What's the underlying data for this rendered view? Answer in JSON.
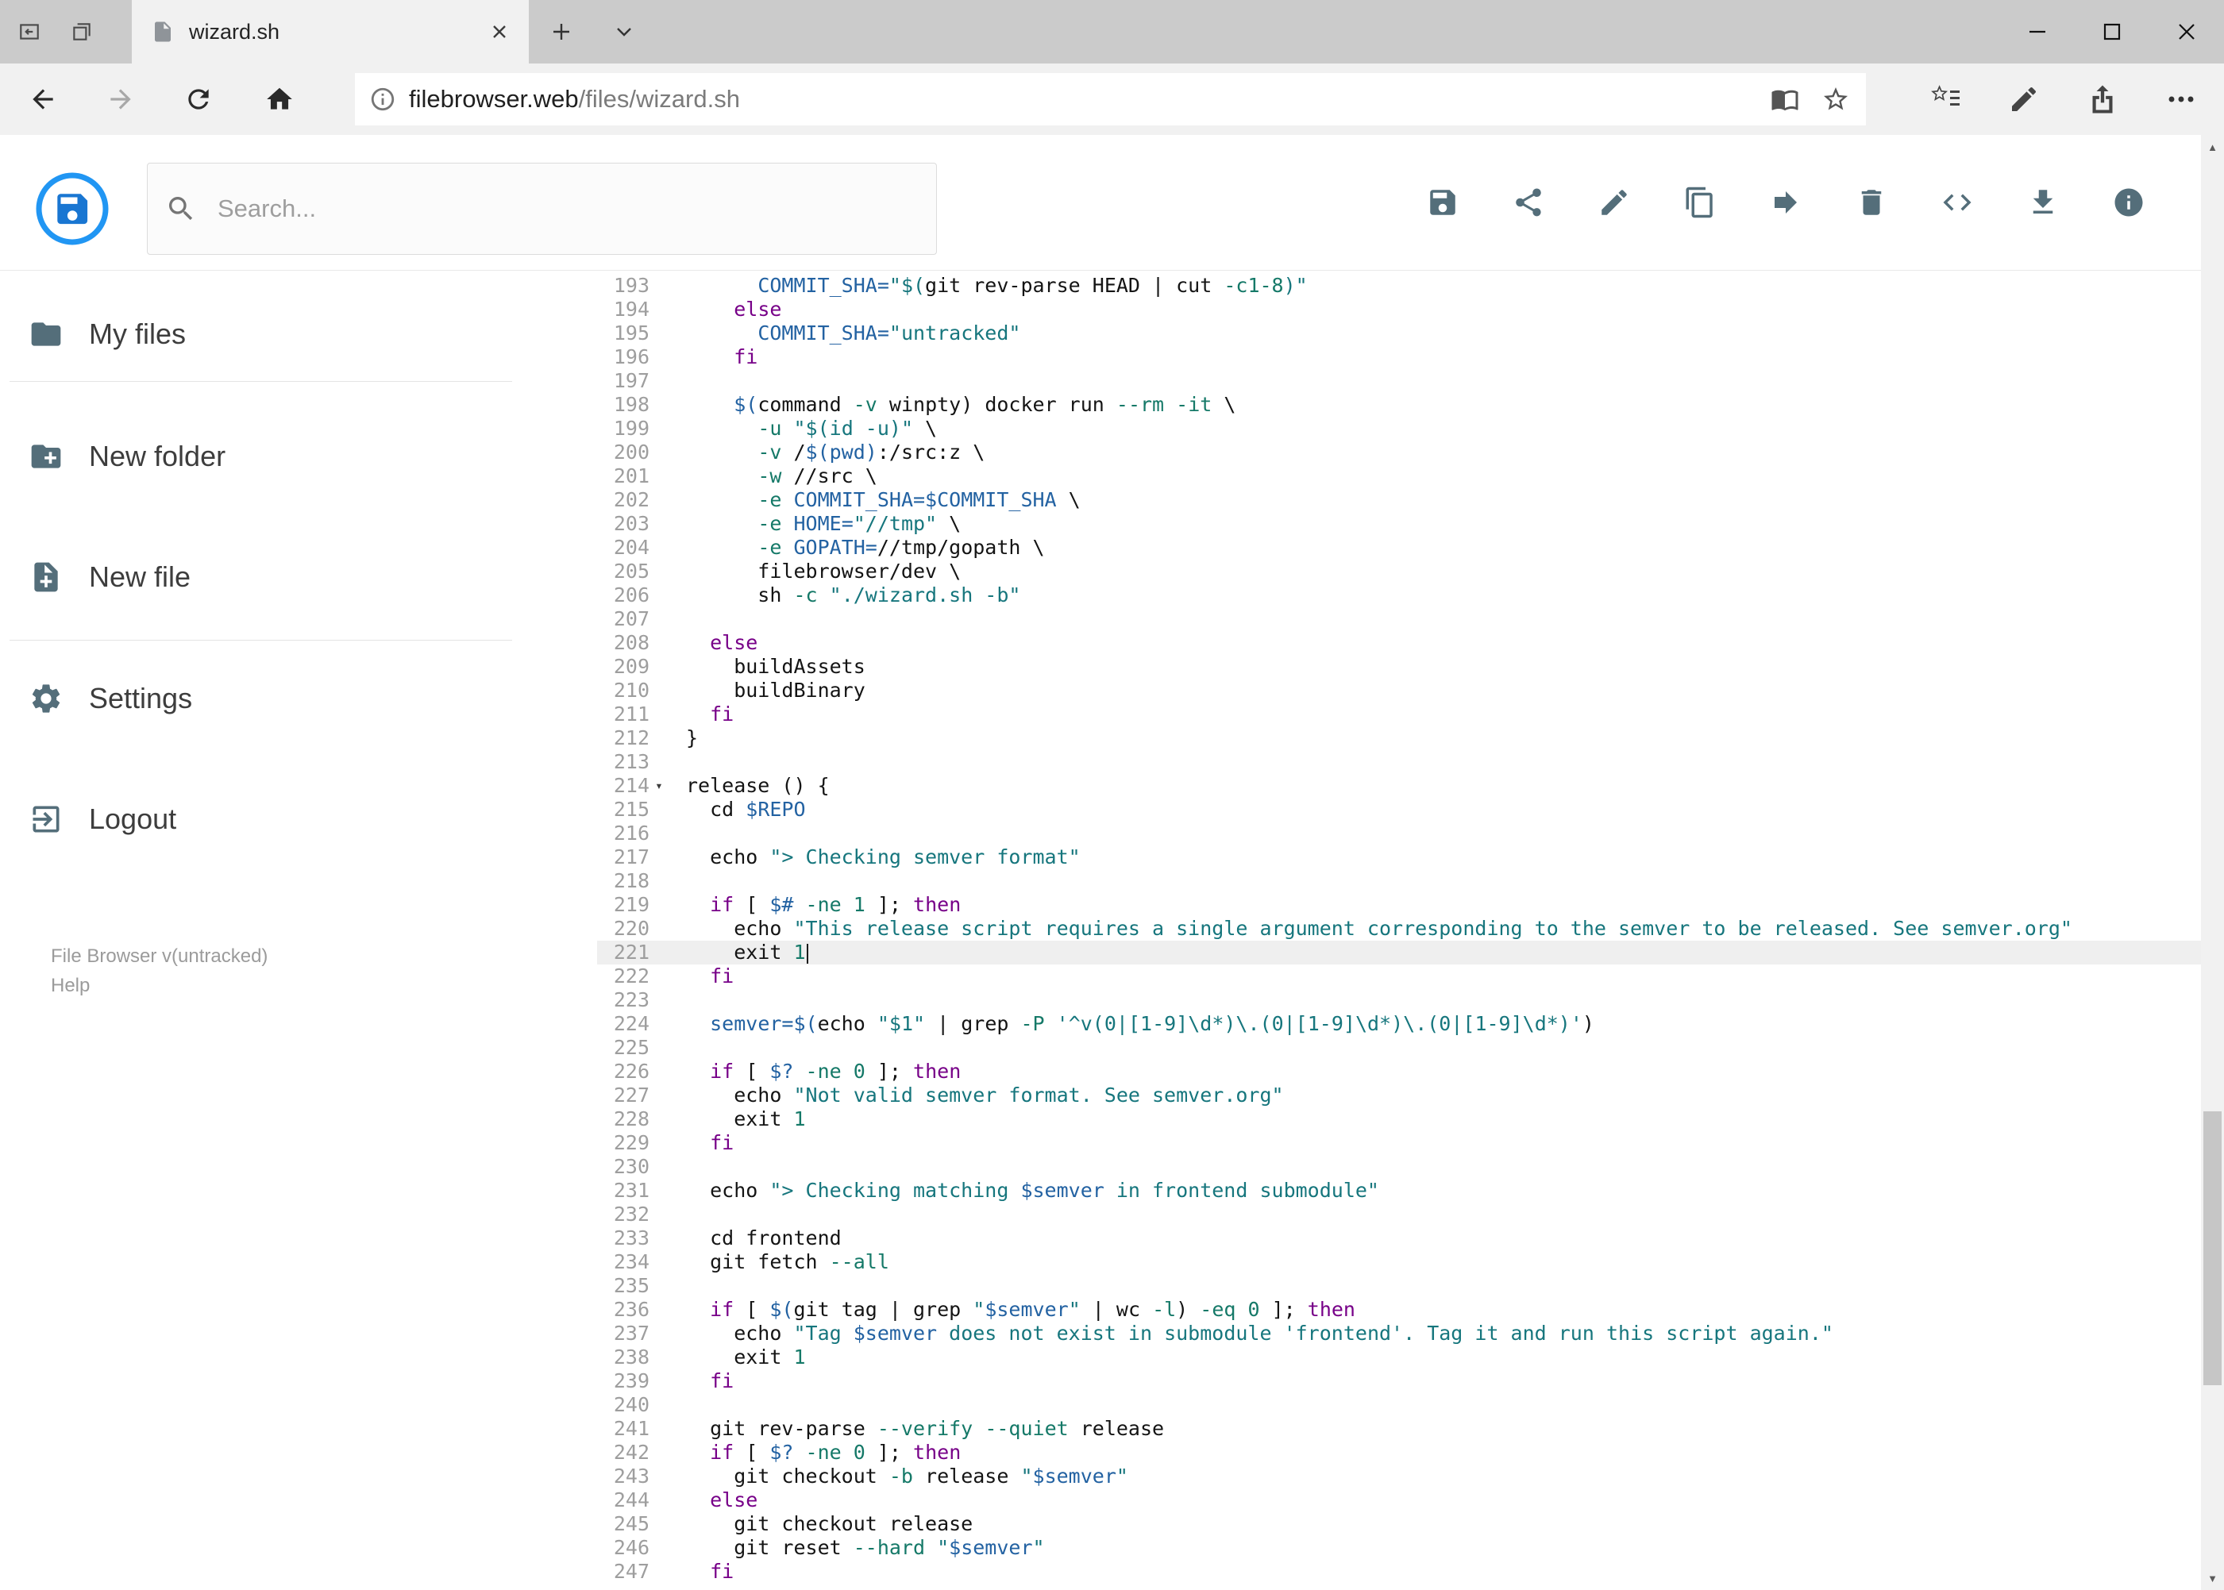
{
  "browser": {
    "tab_title": "wizard.sh",
    "url_domain": "filebrowser.web",
    "url_path": "/files/wizard.sh"
  },
  "header": {
    "search_placeholder": "Search...",
    "toolbar_icons": [
      "save-icon",
      "share-icon",
      "edit-icon",
      "copy-icon",
      "move-icon",
      "delete-icon",
      "code-icon",
      "download-icon",
      "info-icon"
    ]
  },
  "sidebar": {
    "items": [
      {
        "label": "My files",
        "icon": "folder-icon"
      },
      {
        "label": "New folder",
        "icon": "new-folder-icon"
      },
      {
        "label": "New file",
        "icon": "new-file-icon"
      },
      {
        "label": "Settings",
        "icon": "settings-gear-icon"
      },
      {
        "label": "Logout",
        "icon": "logout-icon"
      }
    ],
    "footer_version": "File Browser v(untracked)",
    "footer_help": "Help"
  },
  "colors": {
    "accent_blue": "#2196f3",
    "icon_gray": "#546e7a",
    "keyword": "#770088",
    "string": "#16767d",
    "variable": "#2362a2",
    "number": "#157968",
    "active_line_bg": "#efefef"
  },
  "editor": {
    "active_line": 221,
    "fold_lines": [
      214
    ],
    "lines": [
      {
        "no": 193,
        "t": [
          [
            "p",
            "      "
          ],
          [
            "v",
            "COMMIT_SHA="
          ],
          [
            "s",
            "\"$("
          ],
          [
            "p",
            "git rev-parse HEAD | cut "
          ],
          [
            "n",
            "-c1-8"
          ],
          [
            "s",
            ")\""
          ]
        ]
      },
      {
        "no": 194,
        "t": [
          [
            "p",
            "    "
          ],
          [
            "k",
            "else"
          ]
        ]
      },
      {
        "no": 195,
        "t": [
          [
            "p",
            "      "
          ],
          [
            "v",
            "COMMIT_SHA="
          ],
          [
            "s",
            "\"untracked\""
          ]
        ]
      },
      {
        "no": 196,
        "t": [
          [
            "p",
            "    "
          ],
          [
            "k",
            "fi"
          ]
        ]
      },
      {
        "no": 197,
        "t": []
      },
      {
        "no": 198,
        "t": [
          [
            "p",
            "    "
          ],
          [
            "v",
            "$("
          ],
          [
            "p",
            "command "
          ],
          [
            "n",
            "-v"
          ],
          [
            "p",
            " winpty) docker run "
          ],
          [
            "n",
            "--rm"
          ],
          [
            "p",
            " "
          ],
          [
            "n",
            "-it"
          ],
          [
            "p",
            " \\"
          ]
        ]
      },
      {
        "no": 199,
        "t": [
          [
            "p",
            "      "
          ],
          [
            "n",
            "-u"
          ],
          [
            "p",
            " "
          ],
          [
            "s",
            "\"$(id -u)\""
          ],
          [
            "p",
            " \\"
          ]
        ]
      },
      {
        "no": 200,
        "t": [
          [
            "p",
            "      "
          ],
          [
            "n",
            "-v"
          ],
          [
            "p",
            " /"
          ],
          [
            "v",
            "$(pwd)"
          ],
          [
            "p",
            ":/src:z \\"
          ]
        ]
      },
      {
        "no": 201,
        "t": [
          [
            "p",
            "      "
          ],
          [
            "n",
            "-w"
          ],
          [
            "p",
            " //src \\"
          ]
        ]
      },
      {
        "no": 202,
        "t": [
          [
            "p",
            "      "
          ],
          [
            "n",
            "-e"
          ],
          [
            "p",
            " "
          ],
          [
            "v",
            "COMMIT_SHA=$COMMIT_SHA"
          ],
          [
            "p",
            " \\"
          ]
        ]
      },
      {
        "no": 203,
        "t": [
          [
            "p",
            "      "
          ],
          [
            "n",
            "-e"
          ],
          [
            "p",
            " "
          ],
          [
            "v",
            "HOME="
          ],
          [
            "s",
            "\"//tmp\""
          ],
          [
            "p",
            " \\"
          ]
        ]
      },
      {
        "no": 204,
        "t": [
          [
            "p",
            "      "
          ],
          [
            "n",
            "-e"
          ],
          [
            "p",
            " "
          ],
          [
            "v",
            "GOPATH="
          ],
          [
            "p",
            "//tmp/gopath \\"
          ]
        ]
      },
      {
        "no": 205,
        "t": [
          [
            "p",
            "      filebrowser/dev \\"
          ]
        ]
      },
      {
        "no": 206,
        "t": [
          [
            "p",
            "      sh "
          ],
          [
            "n",
            "-c"
          ],
          [
            "p",
            " "
          ],
          [
            "s",
            "\"./wizard.sh -b\""
          ]
        ]
      },
      {
        "no": 207,
        "t": []
      },
      {
        "no": 208,
        "t": [
          [
            "p",
            "  "
          ],
          [
            "k",
            "else"
          ]
        ]
      },
      {
        "no": 209,
        "t": [
          [
            "p",
            "    buildAssets"
          ]
        ]
      },
      {
        "no": 210,
        "t": [
          [
            "p",
            "    buildBinary"
          ]
        ]
      },
      {
        "no": 211,
        "t": [
          [
            "p",
            "  "
          ],
          [
            "k",
            "fi"
          ]
        ]
      },
      {
        "no": 212,
        "t": [
          [
            "p",
            "}"
          ]
        ]
      },
      {
        "no": 213,
        "t": []
      },
      {
        "no": 214,
        "t": [
          [
            "p",
            "release () {"
          ]
        ]
      },
      {
        "no": 215,
        "t": [
          [
            "p",
            "  cd "
          ],
          [
            "v",
            "$REPO"
          ]
        ]
      },
      {
        "no": 216,
        "t": []
      },
      {
        "no": 217,
        "t": [
          [
            "p",
            "  echo "
          ],
          [
            "s",
            "\"> Checking semver format\""
          ]
        ]
      },
      {
        "no": 218,
        "t": []
      },
      {
        "no": 219,
        "t": [
          [
            "p",
            "  "
          ],
          [
            "k",
            "if"
          ],
          [
            "p",
            " [ "
          ],
          [
            "v",
            "$#"
          ],
          [
            "p",
            " "
          ],
          [
            "n",
            "-ne"
          ],
          [
            "p",
            " "
          ],
          [
            "n",
            "1"
          ],
          [
            "p",
            " ]; "
          ],
          [
            "k",
            "then"
          ]
        ]
      },
      {
        "no": 220,
        "t": [
          [
            "p",
            "    echo "
          ],
          [
            "s",
            "\"This release script requires a single argument corresponding to the semver to be released. See semver.org\""
          ]
        ]
      },
      {
        "no": 221,
        "t": [
          [
            "p",
            "    exit "
          ],
          [
            "n",
            "1"
          ]
        ]
      },
      {
        "no": 222,
        "t": [
          [
            "p",
            "  "
          ],
          [
            "k",
            "fi"
          ]
        ]
      },
      {
        "no": 223,
        "t": []
      },
      {
        "no": 224,
        "t": [
          [
            "p",
            "  "
          ],
          [
            "v",
            "semver=$("
          ],
          [
            "p",
            "echo "
          ],
          [
            "s",
            "\"$1\""
          ],
          [
            "p",
            " | grep "
          ],
          [
            "n",
            "-P"
          ],
          [
            "p",
            " "
          ],
          [
            "s",
            "'^v(0|[1-9]\\d*)\\.(0|[1-9]\\d*)\\.(0|[1-9]\\d*)'"
          ],
          [
            "p",
            ")"
          ]
        ]
      },
      {
        "no": 225,
        "t": []
      },
      {
        "no": 226,
        "t": [
          [
            "p",
            "  "
          ],
          [
            "k",
            "if"
          ],
          [
            "p",
            " [ "
          ],
          [
            "v",
            "$?"
          ],
          [
            "p",
            " "
          ],
          [
            "n",
            "-ne"
          ],
          [
            "p",
            " "
          ],
          [
            "n",
            "0"
          ],
          [
            "p",
            " ]; "
          ],
          [
            "k",
            "then"
          ]
        ]
      },
      {
        "no": 227,
        "t": [
          [
            "p",
            "    echo "
          ],
          [
            "s",
            "\"Not valid semver format. See semver.org\""
          ]
        ]
      },
      {
        "no": 228,
        "t": [
          [
            "p",
            "    exit "
          ],
          [
            "n",
            "1"
          ]
        ]
      },
      {
        "no": 229,
        "t": [
          [
            "p",
            "  "
          ],
          [
            "k",
            "fi"
          ]
        ]
      },
      {
        "no": 230,
        "t": []
      },
      {
        "no": 231,
        "t": [
          [
            "p",
            "  echo "
          ],
          [
            "s",
            "\"> Checking matching "
          ],
          [
            "v",
            "$semver"
          ],
          [
            "s",
            " in frontend submodule\""
          ]
        ]
      },
      {
        "no": 232,
        "t": []
      },
      {
        "no": 233,
        "t": [
          [
            "p",
            "  cd frontend"
          ]
        ]
      },
      {
        "no": 234,
        "t": [
          [
            "p",
            "  git fetch "
          ],
          [
            "n",
            "--all"
          ]
        ]
      },
      {
        "no": 235,
        "t": []
      },
      {
        "no": 236,
        "t": [
          [
            "p",
            "  "
          ],
          [
            "k",
            "if"
          ],
          [
            "p",
            " [ "
          ],
          [
            "v",
            "$("
          ],
          [
            "p",
            "git tag | grep "
          ],
          [
            "s",
            "\""
          ],
          [
            "v",
            "$semver"
          ],
          [
            "s",
            "\""
          ],
          [
            "p",
            " | wc "
          ],
          [
            "n",
            "-l"
          ],
          [
            "p",
            ") "
          ],
          [
            "n",
            "-eq"
          ],
          [
            "p",
            " "
          ],
          [
            "n",
            "0"
          ],
          [
            "p",
            " ]; "
          ],
          [
            "k",
            "then"
          ]
        ]
      },
      {
        "no": 237,
        "t": [
          [
            "p",
            "    echo "
          ],
          [
            "s",
            "\"Tag "
          ],
          [
            "v",
            "$semver"
          ],
          [
            "s",
            " does not exist in submodule 'frontend'. Tag it and run this script again.\""
          ]
        ]
      },
      {
        "no": 238,
        "t": [
          [
            "p",
            "    exit "
          ],
          [
            "n",
            "1"
          ]
        ]
      },
      {
        "no": 239,
        "t": [
          [
            "p",
            "  "
          ],
          [
            "k",
            "fi"
          ]
        ]
      },
      {
        "no": 240,
        "t": []
      },
      {
        "no": 241,
        "t": [
          [
            "p",
            "  git rev-parse "
          ],
          [
            "n",
            "--verify"
          ],
          [
            "p",
            " "
          ],
          [
            "n",
            "--quiet"
          ],
          [
            "p",
            " release"
          ]
        ]
      },
      {
        "no": 242,
        "t": [
          [
            "p",
            "  "
          ],
          [
            "k",
            "if"
          ],
          [
            "p",
            " [ "
          ],
          [
            "v",
            "$?"
          ],
          [
            "p",
            " "
          ],
          [
            "n",
            "-ne"
          ],
          [
            "p",
            " "
          ],
          [
            "n",
            "0"
          ],
          [
            "p",
            " ]; "
          ],
          [
            "k",
            "then"
          ]
        ]
      },
      {
        "no": 243,
        "t": [
          [
            "p",
            "    git checkout "
          ],
          [
            "n",
            "-b"
          ],
          [
            "p",
            " release "
          ],
          [
            "s",
            "\""
          ],
          [
            "v",
            "$semver"
          ],
          [
            "s",
            "\""
          ]
        ]
      },
      {
        "no": 244,
        "t": [
          [
            "p",
            "  "
          ],
          [
            "k",
            "else"
          ]
        ]
      },
      {
        "no": 245,
        "t": [
          [
            "p",
            "    git checkout release"
          ]
        ]
      },
      {
        "no": 246,
        "t": [
          [
            "p",
            "    git reset "
          ],
          [
            "n",
            "--hard"
          ],
          [
            "p",
            " "
          ],
          [
            "s",
            "\""
          ],
          [
            "v",
            "$semver"
          ],
          [
            "s",
            "\""
          ]
        ]
      },
      {
        "no": 247,
        "t": [
          [
            "p",
            "  "
          ],
          [
            "k",
            "fi"
          ]
        ]
      }
    ]
  }
}
